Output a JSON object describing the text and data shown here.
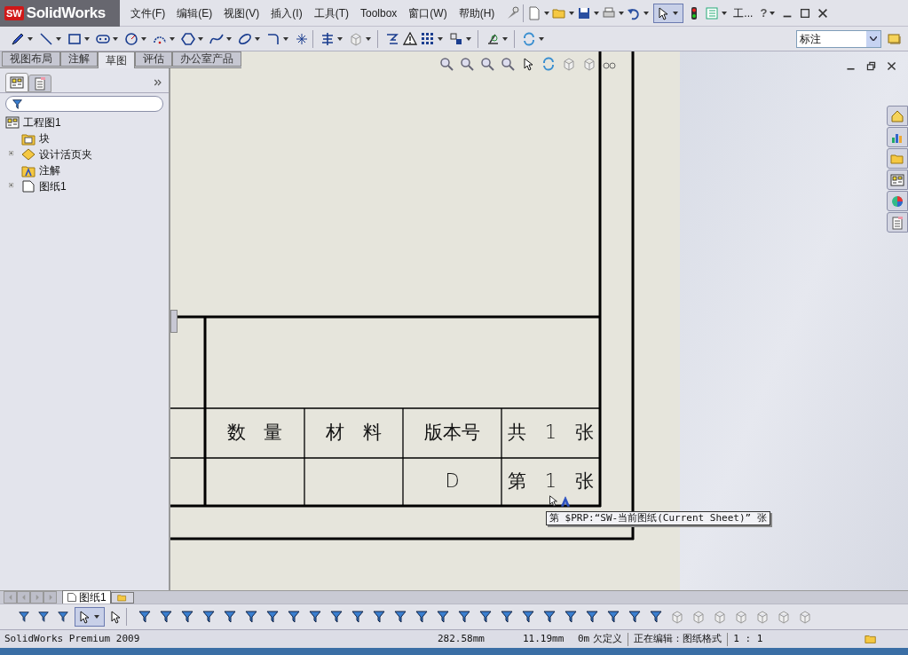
{
  "app_logo": {
    "mark": "SW",
    "name": "SolidWorks"
  },
  "menu": [
    "文件(F)",
    "编辑(E)",
    "视图(V)",
    "插入(I)",
    "工具(T)",
    "Toolbox",
    "窗口(W)",
    "帮助(H)"
  ],
  "top_toolbar": {
    "truncated_label": "工...",
    "help_glyph": "?"
  },
  "annotation_style": {
    "value": "标注"
  },
  "command_tabs": [
    {
      "label": "视图布局",
      "selected": false
    },
    {
      "label": "注解",
      "selected": false
    },
    {
      "label": "草图",
      "selected": true
    },
    {
      "label": "评估",
      "selected": false
    },
    {
      "label": "办公室产品",
      "selected": false
    }
  ],
  "panel_tabs": [
    {
      "kind": "tree",
      "selected": true
    },
    {
      "kind": "properties",
      "selected": false
    }
  ],
  "tree": {
    "label": "工程图1",
    "children": [
      {
        "label": "块",
        "kind": "block",
        "expandable": false
      },
      {
        "label": "设计活页夹",
        "kind": "binder",
        "expandable": true
      },
      {
        "label": "注解",
        "kind": "annotations",
        "expandable": false
      },
      {
        "label": "图纸1",
        "kind": "sheet",
        "expandable": true
      }
    ]
  },
  "title_block": {
    "header_row": [
      "数 量",
      "材 料",
      "版本号",
      "共 1 张"
    ],
    "value_row": {
      "column_3": "D",
      "column_4": "第 1 张"
    }
  },
  "tooltip": "第 $PRP:“SW-当前图纸(Current Sheet)” 张",
  "sheet_tabs": [
    {
      "label": "图纸1",
      "selected": true
    }
  ],
  "status_bar": {
    "edition": "SolidWorks Premium 2009",
    "x": "282.58mm",
    "y": "11.19mm",
    "z": "0m",
    "state": "欠定义",
    "editing": "正在编辑：图纸格式",
    "scale": "1 : 1"
  }
}
